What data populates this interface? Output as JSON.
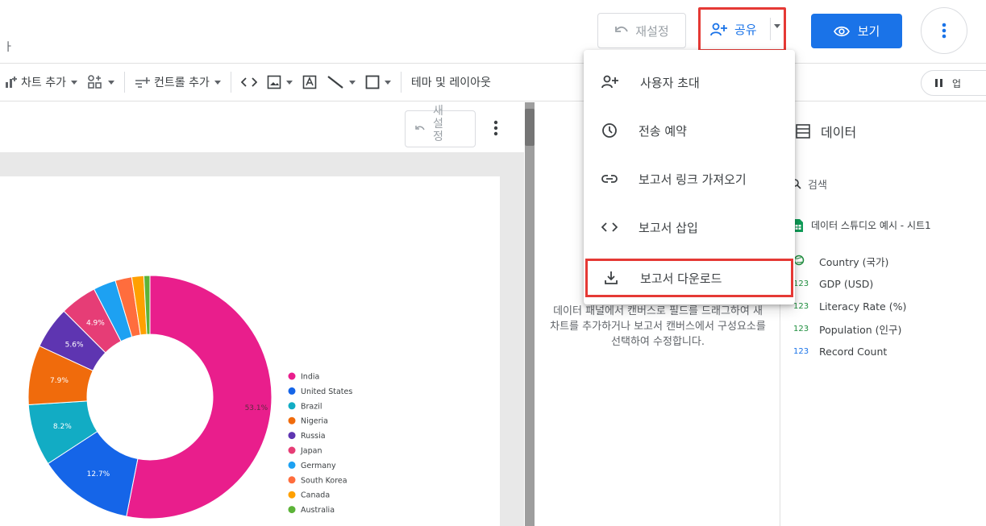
{
  "header": {
    "title_fragment": "ㅏ",
    "reset_label": "재설정",
    "share_label": "공유",
    "view_label": "보기"
  },
  "toolbar": {
    "add_chart": "차트 추가",
    "add_control": "컨트롤 추가",
    "theme": "테마 및 레이아웃",
    "layout_short": "업"
  },
  "canvas": {
    "reset_chars": [
      "새",
      "설",
      "정"
    ]
  },
  "share_menu": {
    "items": [
      {
        "label": "사용자 초대",
        "icon": "person-add-icon"
      },
      {
        "label": "전송 예약",
        "icon": "clock-icon"
      },
      {
        "label": "보고서 링크 가져오기",
        "icon": "link-icon"
      },
      {
        "label": "보고서 삽입",
        "icon": "code-icon"
      },
      {
        "label": "보고서 다운로드",
        "icon": "download-icon"
      }
    ]
  },
  "properties": {
    "empty_hint": "데이터 패널에서 캔버스로 필드를 드래그하여 새 차트를 추가하거나 보고서 캔버스에서 구성요소를 선택하여 수정합니다."
  },
  "data_panel": {
    "title": "데이터",
    "search_placeholder": "검색",
    "source_name": "데이터 스튜디오 예시 - 시트1",
    "fields": [
      {
        "type": "ABC",
        "name": "Country (국가)"
      },
      {
        "type": "123",
        "name": "GDP (USD)"
      },
      {
        "type": "123",
        "name": "Literacy Rate (%)"
      },
      {
        "type": "123",
        "name": "Population (인구)"
      },
      {
        "type": "123",
        "name": "Record Count"
      }
    ]
  },
  "colors": {
    "accent": "#1a73e8",
    "highlight": "#e53935"
  },
  "chart_data": {
    "type": "pie",
    "categories": [
      "India",
      "United States",
      "Brazil",
      "Nigeria",
      "Russia",
      "Japan",
      "Germany",
      "South Korea",
      "Canada",
      "Australia"
    ],
    "values": [
      53.1,
      12.7,
      8.2,
      7.9,
      5.6,
      4.9,
      3.0,
      2.2,
      1.6,
      0.8
    ],
    "data_labels": [
      "53.1%",
      "12.7%",
      "8.2%",
      "7.9%",
      "5.6%",
      "4.9%",
      "",
      "",
      "",
      ""
    ],
    "colors": [
      "#e91e8c",
      "#1565e8",
      "#12acc4",
      "#f06b0c",
      "#5e35b1",
      "#e63d76",
      "#1da1f2",
      "#ff6d3d",
      "#ffa000",
      "#5cb338"
    ],
    "donut": true,
    "legend": "right"
  }
}
